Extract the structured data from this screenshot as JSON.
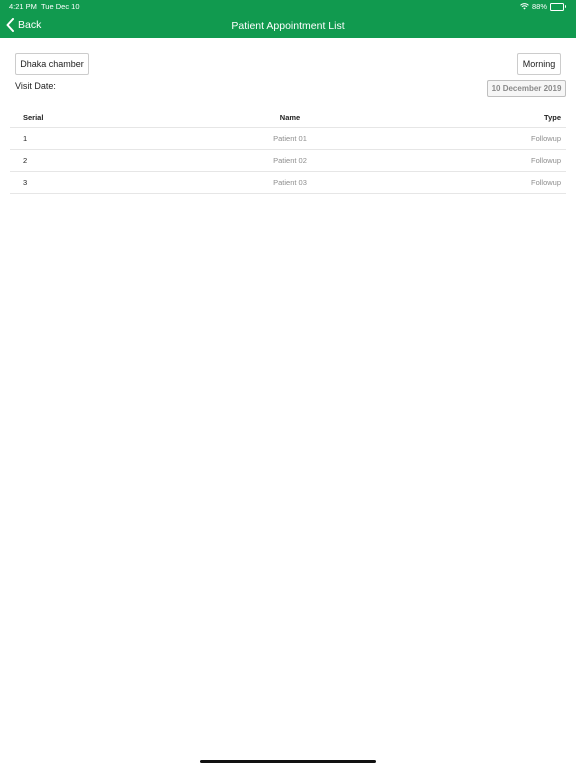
{
  "status_bar": {
    "time": "4:21 PM",
    "date": "Tue Dec 10",
    "battery": "88%",
    "battery_level": 0.88
  },
  "nav": {
    "back_label": "Back",
    "title": "Patient Appointment List"
  },
  "controls": {
    "chamber": "Dhaka chamber",
    "session": "Morning",
    "visit_date_label": "Visit Date:",
    "visit_date": "10 December 2019"
  },
  "table": {
    "headers": [
      "Serial",
      "Name",
      "Type"
    ],
    "rows": [
      {
        "serial": "1",
        "name": "Patient 01",
        "type": "Followup"
      },
      {
        "serial": "2",
        "name": "Patient 02",
        "type": "Followup"
      },
      {
        "serial": "3",
        "name": "Patient 03",
        "type": "Followup"
      }
    ]
  },
  "colors": {
    "nav_background": "#119a4f",
    "nav_text": "#ffffff"
  },
  "icons": [
    "wifi-icon",
    "battery-icon",
    "chevron-left-icon"
  ]
}
